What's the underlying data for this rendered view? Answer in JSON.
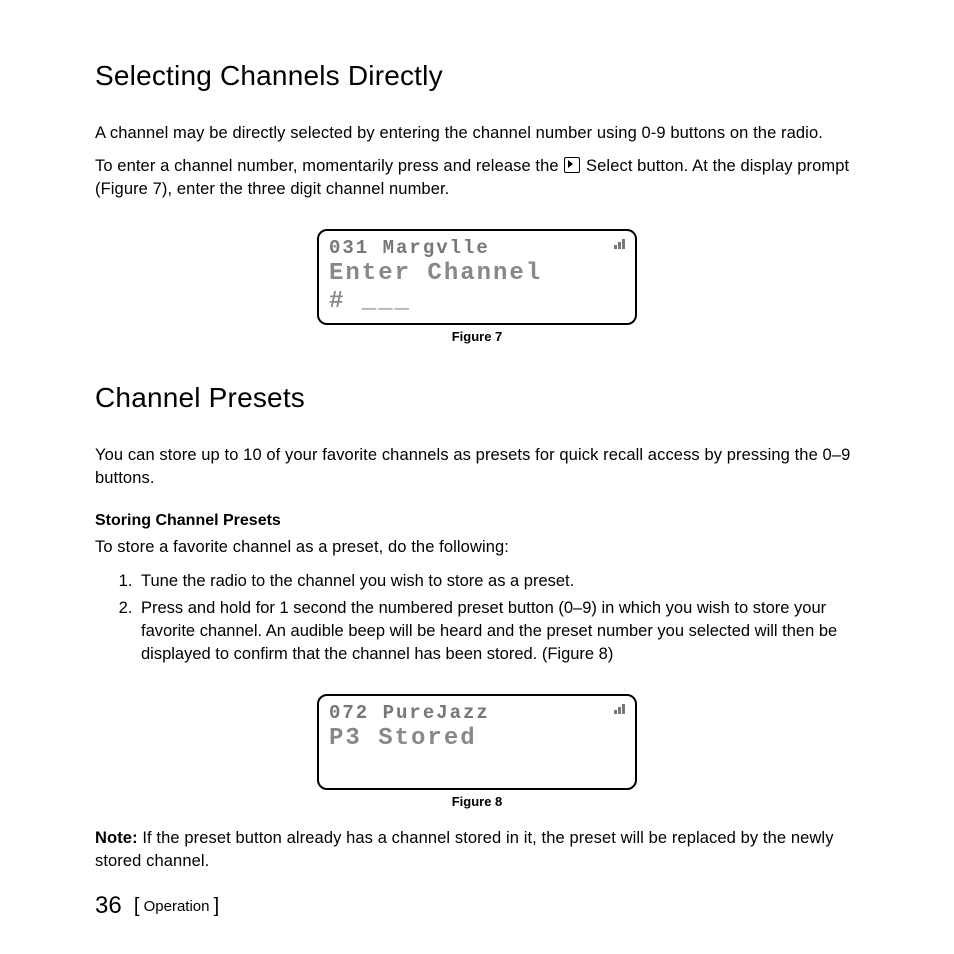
{
  "section1": {
    "heading": "Selecting Channels Directly",
    "p1": "A channel may be directly selected by entering the channel number using 0-9 buttons on the radio.",
    "p2a": "To enter a channel number, momentarily press and release the ",
    "p2b": " Select button. At the display prompt (Figure 7), enter the three digit channel number."
  },
  "figure7": {
    "line1": "031 Margvlle",
    "line2": "Enter Channel\n# ___",
    "caption": "Figure 7"
  },
  "section2": {
    "heading": "Channel Presets",
    "p1": "You can store up to 10 of your favorite channels as presets for quick recall access by pressing the 0–9 buttons.",
    "subhead": "Storing Channel Presets",
    "p2": "To store a favorite channel as a preset, do the following:",
    "steps": [
      "Tune the radio to the channel you wish to store as a preset.",
      "Press and hold for 1 second the numbered preset button (0–9) in which you wish to store your favorite channel. An audible beep will be heard and the preset number you selected will then be displayed to confirm that the channel has been stored. (Figure 8)"
    ]
  },
  "figure8": {
    "line1": "072 PureJazz",
    "line2": "P3 Stored\n ",
    "caption": "Figure 8"
  },
  "note": {
    "lead": "Note:",
    "text": " If the preset button already has a channel stored in it, the preset will be replaced by the newly stored channel."
  },
  "footer": {
    "page": "36",
    "section": "Operation"
  }
}
